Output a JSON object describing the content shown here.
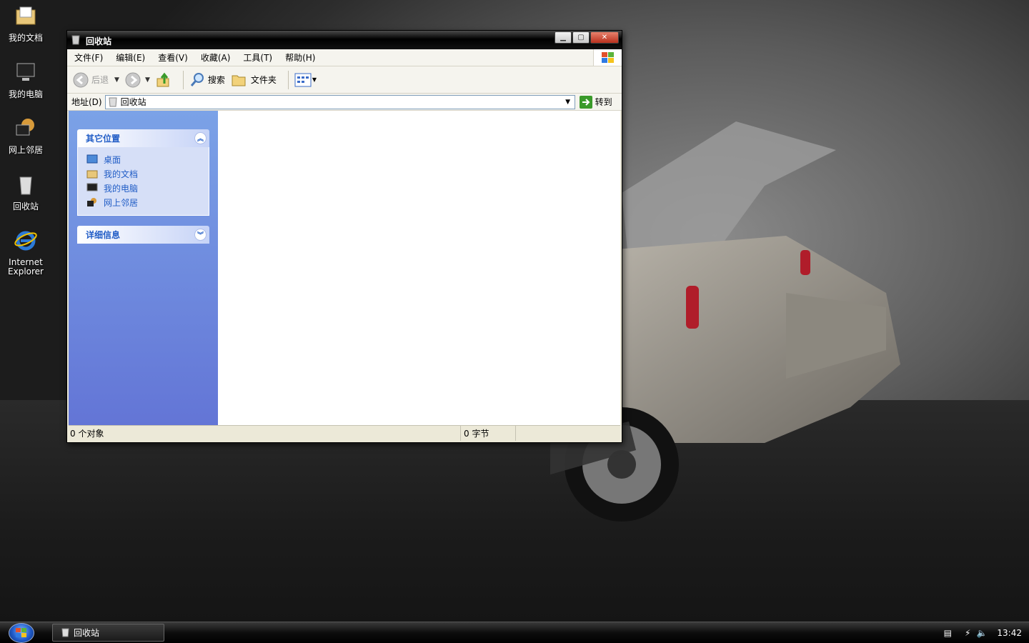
{
  "desktop": {
    "icons": [
      {
        "label": "我的文档"
      },
      {
        "label": "我的电脑"
      },
      {
        "label": "网上邻居"
      },
      {
        "label": "回收站"
      },
      {
        "label_line1": "Internet",
        "label_line2": "Explorer"
      }
    ]
  },
  "window": {
    "title": "回收站",
    "menu": [
      "文件(F)",
      "编辑(E)",
      "查看(V)",
      "收藏(A)",
      "工具(T)",
      "帮助(H)"
    ],
    "toolbar": {
      "back_label": "后退",
      "search_label": "搜索",
      "folders_label": "文件夹"
    },
    "address": {
      "label": "地址(D)",
      "value": "回收站",
      "go_label": "转到"
    },
    "taskpane": {
      "other_places": {
        "title": "其它位置",
        "items": [
          "桌面",
          "我的文档",
          "我的电脑",
          "网上邻居"
        ]
      },
      "details": {
        "title": "详细信息"
      }
    },
    "status": {
      "objects": "0 个对象",
      "size": "0 字节"
    }
  },
  "taskbar": {
    "task_label": "回收站",
    "clock": "13:42"
  },
  "colors": {
    "task_link": "#215dc6",
    "pane_top": "#7ba2e7",
    "pane_bottom": "#6375d6",
    "close_button": "#c8432a"
  }
}
